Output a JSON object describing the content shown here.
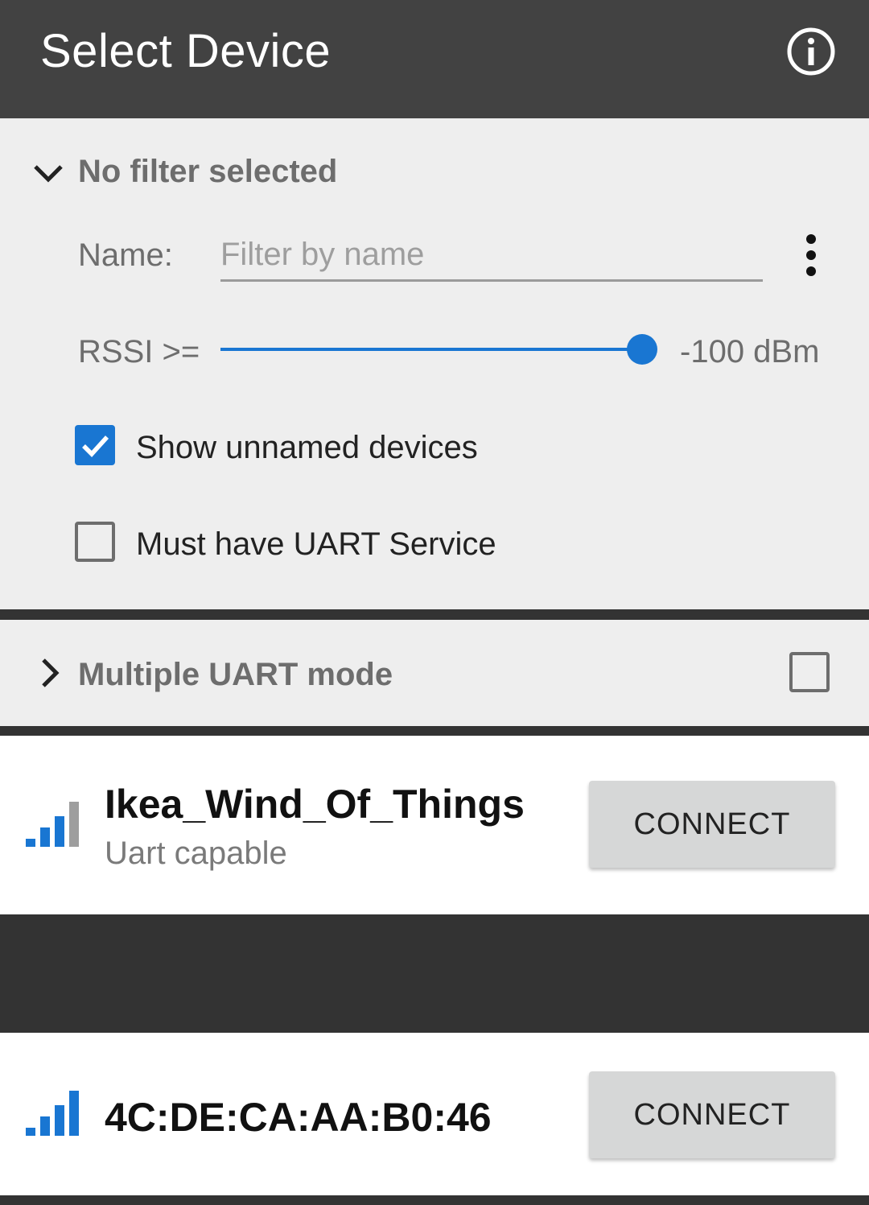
{
  "appbar": {
    "title": "Select Device",
    "info_icon": "info-icon"
  },
  "filter": {
    "heading": "No filter selected",
    "name_label": "Name:",
    "name_placeholder": "Filter by name",
    "name_value": "",
    "rssi_label": "RSSI >=",
    "rssi_value_text": "-100 dBm",
    "rssi_slider_level": 1.0,
    "show_unnamed_label": "Show unnamed devices",
    "show_unnamed_checked": true,
    "uart_only_label": "Must have UART Service",
    "uart_only_checked": false
  },
  "multi_uart": {
    "label": "Multiple UART mode",
    "checked": false
  },
  "devices": [
    {
      "name": "Ikea_Wind_Of_Things",
      "subtitle": "Uart capable",
      "connect_label": "CONNECT",
      "signal_bars": 3
    },
    {
      "name": "4C:DE:CA:AA:B0:46",
      "subtitle": "",
      "connect_label": "CONNECT",
      "signal_bars": 4
    }
  ],
  "colors": {
    "accent": "#1976d2",
    "appbar": "#424242",
    "panel": "#eeeeee"
  }
}
